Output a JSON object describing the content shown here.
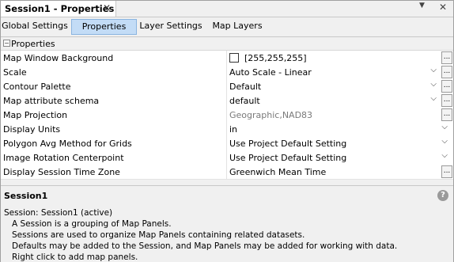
{
  "window": {
    "tab_title": "Session1 - Properties",
    "close_glyph": "✕",
    "menu_glyph": "▼",
    "pane_close_glyph": "✕"
  },
  "tabs": [
    {
      "label": "Global Settings",
      "active": false
    },
    {
      "label": "Properties",
      "active": true
    },
    {
      "label": "Layer Settings",
      "active": false
    },
    {
      "label": "Map Layers",
      "active": false
    }
  ],
  "grid": {
    "category": "Properties",
    "category_toggle": "−",
    "rows": [
      {
        "name": "Map Window Background",
        "value": "[255,255,255]",
        "editor": "color"
      },
      {
        "name": "Scale",
        "value": "Auto Scale - Linear",
        "editor": "dropdown-ellipsis"
      },
      {
        "name": "Contour Palette",
        "value": "Default",
        "editor": "dropdown-ellipsis"
      },
      {
        "name": "Map attribute schema",
        "value": "default",
        "editor": "dropdown-ellipsis"
      },
      {
        "name": "Map Projection",
        "value": "Geographic,NAD83",
        "editor": "ellipsis-readonly"
      },
      {
        "name": "Display Units",
        "value": "in",
        "editor": "dropdown"
      },
      {
        "name": "Polygon Avg Method for Grids",
        "value": "Use Project Default Setting",
        "editor": "dropdown"
      },
      {
        "name": "Image Rotation Centerpoint",
        "value": "Use Project Default Setting",
        "editor": "dropdown"
      },
      {
        "name": "Display Session Time Zone",
        "value": "Greenwich Mean Time",
        "editor": "ellipsis"
      }
    ],
    "dropdown_glyph": "⌵",
    "ellipsis_glyph": "..."
  },
  "help": {
    "title": "Session1",
    "icon": "?",
    "lines": [
      "Session: Session1 (active)",
      "A Session is a grouping of Map Panels.",
      "Sessions are used to organize Map Panels containing related datasets.",
      "Defaults may be added to the Session, and Map Panels may be added for working with data.",
      "Right click to add map panels."
    ]
  }
}
